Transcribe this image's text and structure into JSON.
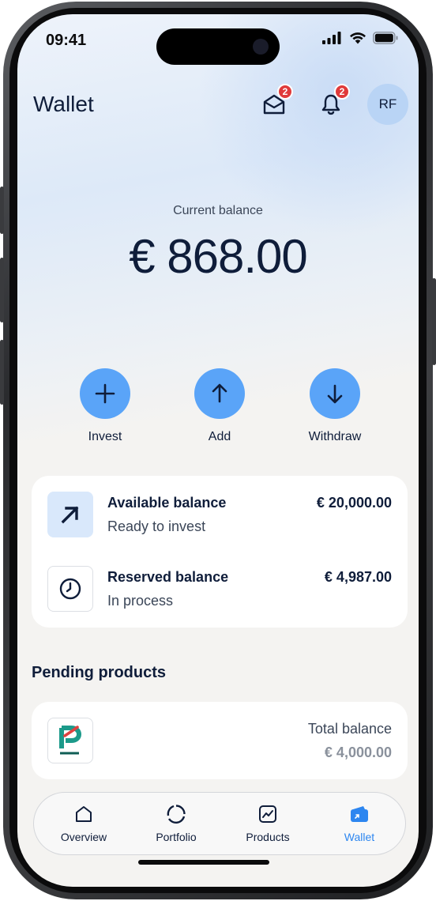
{
  "status_bar": {
    "time": "09:41"
  },
  "header": {
    "title": "Wallet",
    "messages_badge": "2",
    "notifications_badge": "2",
    "avatar_initials": "RF"
  },
  "balance": {
    "label": "Current balance",
    "amount": "€ 868.00"
  },
  "actions": [
    {
      "label": "Invest",
      "icon": "plus-icon"
    },
    {
      "label": "Add",
      "icon": "arrow-up-icon"
    },
    {
      "label": "Withdraw",
      "icon": "arrow-down-icon"
    }
  ],
  "balances_card": {
    "available": {
      "title": "Available balance",
      "subtitle": "Ready to invest",
      "amount": "€ 20,000.00"
    },
    "reserved": {
      "title": "Reserved balance",
      "subtitle": "In process",
      "amount": "€ 4,987.00"
    }
  },
  "pending": {
    "title": "Pending products",
    "item": {
      "label": "Total balance",
      "amount": "€ 4,000.00"
    }
  },
  "nav": {
    "items": [
      {
        "label": "Overview",
        "icon": "home-icon"
      },
      {
        "label": "Portfolio",
        "icon": "ring-chart-icon"
      },
      {
        "label": "Products",
        "icon": "chart-icon"
      },
      {
        "label": "Wallet",
        "icon": "wallet-icon",
        "active": true
      }
    ]
  },
  "colors": {
    "accent": "#5aa4f8",
    "active_nav": "#2d86f0",
    "badge": "#e03a3a",
    "text": "#0f1d3a"
  }
}
